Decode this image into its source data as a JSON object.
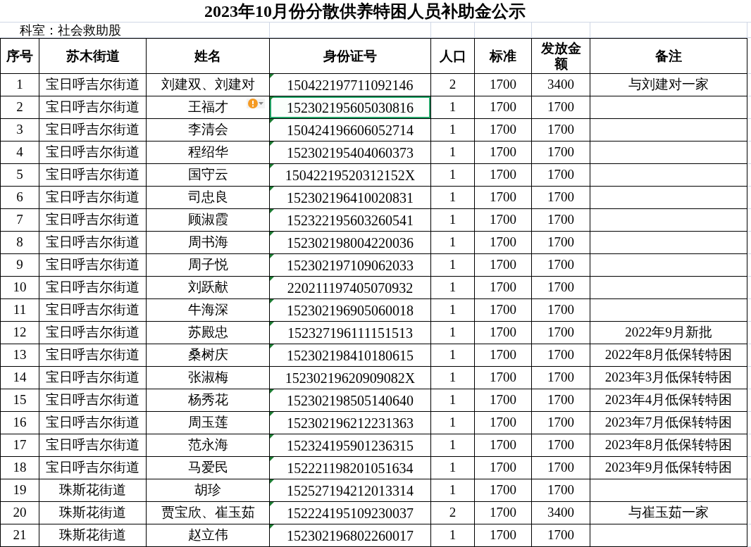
{
  "title": "2023年10月份分散供养特困人员补助金公示",
  "department": "科室：社会救助股",
  "columns": [
    "序号",
    "苏木街道",
    "姓名",
    "身份证号",
    "人口",
    "标准",
    "发放金额",
    "备注"
  ],
  "rows": [
    {
      "no": "1",
      "street": "宝日呼吉尔街道",
      "name": "刘建双、刘建对",
      "id": "150422197711092146",
      "people": "2",
      "standard": "1700",
      "amount": "3400",
      "note": "与刘建对一家",
      "flagged": true,
      "selected": false,
      "warning": false
    },
    {
      "no": "2",
      "street": "宝日呼吉尔街道",
      "name": "王福才",
      "id": "152302195605030816",
      "people": "1",
      "standard": "1700",
      "amount": "1700",
      "note": "",
      "flagged": true,
      "selected": true,
      "warning": true
    },
    {
      "no": "3",
      "street": "宝日呼吉尔街道",
      "name": "李清会",
      "id": "150424196606052714",
      "people": "1",
      "standard": "1700",
      "amount": "1700",
      "note": "",
      "flagged": true,
      "selected": false,
      "warning": false
    },
    {
      "no": "4",
      "street": "宝日呼吉尔街道",
      "name": "程绍华",
      "id": "152302195404060373",
      "people": "1",
      "standard": "1700",
      "amount": "1700",
      "note": "",
      "flagged": true,
      "selected": false,
      "warning": false
    },
    {
      "no": "5",
      "street": "宝日呼吉尔街道",
      "name": "国守云",
      "id": "15042219520312152X",
      "people": "1",
      "standard": "1700",
      "amount": "1700",
      "note": "",
      "flagged": true,
      "selected": false,
      "warning": false
    },
    {
      "no": "6",
      "street": "宝日呼吉尔街道",
      "name": "司忠良",
      "id": "152302196410020831",
      "people": "1",
      "standard": "1700",
      "amount": "1700",
      "note": "",
      "flagged": true,
      "selected": false,
      "warning": false
    },
    {
      "no": "7",
      "street": "宝日呼吉尔街道",
      "name": "顾淑霞",
      "id": "152322195603260541",
      "people": "1",
      "standard": "1700",
      "amount": "1700",
      "note": "",
      "flagged": true,
      "selected": false,
      "warning": false
    },
    {
      "no": "8",
      "street": "宝日呼吉尔街道",
      "name": "周书海",
      "id": "152302198004220036",
      "people": "1",
      "standard": "1700",
      "amount": "1700",
      "note": "",
      "flagged": true,
      "selected": false,
      "warning": false
    },
    {
      "no": "9",
      "street": "宝日呼吉尔街道",
      "name": "周子悦",
      "id": "152302197109062033",
      "people": "1",
      "standard": "1700",
      "amount": "1700",
      "note": "",
      "flagged": true,
      "selected": false,
      "warning": false
    },
    {
      "no": "10",
      "street": "宝日呼吉尔街道",
      "name": "刘跃献",
      "id": "220211197405070932",
      "people": "1",
      "standard": "1700",
      "amount": "1700",
      "note": "",
      "flagged": true,
      "selected": false,
      "warning": false
    },
    {
      "no": "11",
      "street": "宝日呼吉尔街道",
      "name": "牛海深",
      "id": "152302196905060018",
      "people": "1",
      "standard": "1700",
      "amount": "1700",
      "note": "",
      "flagged": true,
      "selected": false,
      "warning": false
    },
    {
      "no": "12",
      "street": "宝日呼吉尔街道",
      "name": "苏殿忠",
      "id": "152327196111151513",
      "people": "1",
      "standard": "1700",
      "amount": "1700",
      "note": "2022年9月新批",
      "flagged": true,
      "selected": false,
      "warning": false
    },
    {
      "no": "13",
      "street": "宝日呼吉尔街道",
      "name": "桑树庆",
      "id": "152302198410180615",
      "people": "1",
      "standard": "1700",
      "amount": "1700",
      "note": "2022年8月低保转特困",
      "flagged": true,
      "selected": false,
      "warning": false
    },
    {
      "no": "14",
      "street": "宝日呼吉尔街道",
      "name": "张淑梅",
      "id": "15230219620909082X",
      "people": "1",
      "standard": "1700",
      "amount": "1700",
      "note": "2023年3月低保转特困",
      "flagged": false,
      "selected": false,
      "warning": false
    },
    {
      "no": "15",
      "street": "宝日呼吉尔街道",
      "name": "杨秀花",
      "id": "152302198505140640",
      "people": "1",
      "standard": "1700",
      "amount": "1700",
      "note": "2023年4月低保转特困",
      "flagged": true,
      "selected": false,
      "warning": false
    },
    {
      "no": "16",
      "street": "宝日呼吉尔街道",
      "name": "周玉莲",
      "id": "152302196212231363",
      "people": "1",
      "standard": "1700",
      "amount": "1700",
      "note": "2023年7月低保转特困",
      "flagged": true,
      "selected": false,
      "warning": false
    },
    {
      "no": "17",
      "street": "宝日呼吉尔街道",
      "name": "范永海",
      "id": "152324195901236315",
      "people": "1",
      "standard": "1700",
      "amount": "1700",
      "note": "2023年8月低保转特困",
      "flagged": true,
      "selected": false,
      "warning": false
    },
    {
      "no": "18",
      "street": "宝日呼吉尔街道",
      "name": "马爱民",
      "id": "152221198201051634",
      "people": "1",
      "standard": "1700",
      "amount": "1700",
      "note": "2023年9月低保转特困",
      "flagged": true,
      "selected": false,
      "warning": false
    },
    {
      "no": "19",
      "street": "珠斯花街道",
      "name": "胡珍",
      "id": "152527194212013314",
      "people": "1",
      "standard": "1700",
      "amount": "1700",
      "note": "",
      "flagged": true,
      "selected": false,
      "warning": false
    },
    {
      "no": "20",
      "street": "珠斯花街道",
      "name": "贾宝欣、崔玉茹",
      "id": "152224195109230037",
      "people": "2",
      "standard": "1700",
      "amount": "3400",
      "note": "与崔玉茹一家",
      "flagged": true,
      "selected": false,
      "warning": false
    },
    {
      "no": "21",
      "street": "珠斯花街道",
      "name": "赵立伟",
      "id": "152302196802260017",
      "people": "1",
      "standard": "1700",
      "amount": "1700",
      "note": "",
      "flagged": true,
      "selected": false,
      "warning": false
    }
  ]
}
